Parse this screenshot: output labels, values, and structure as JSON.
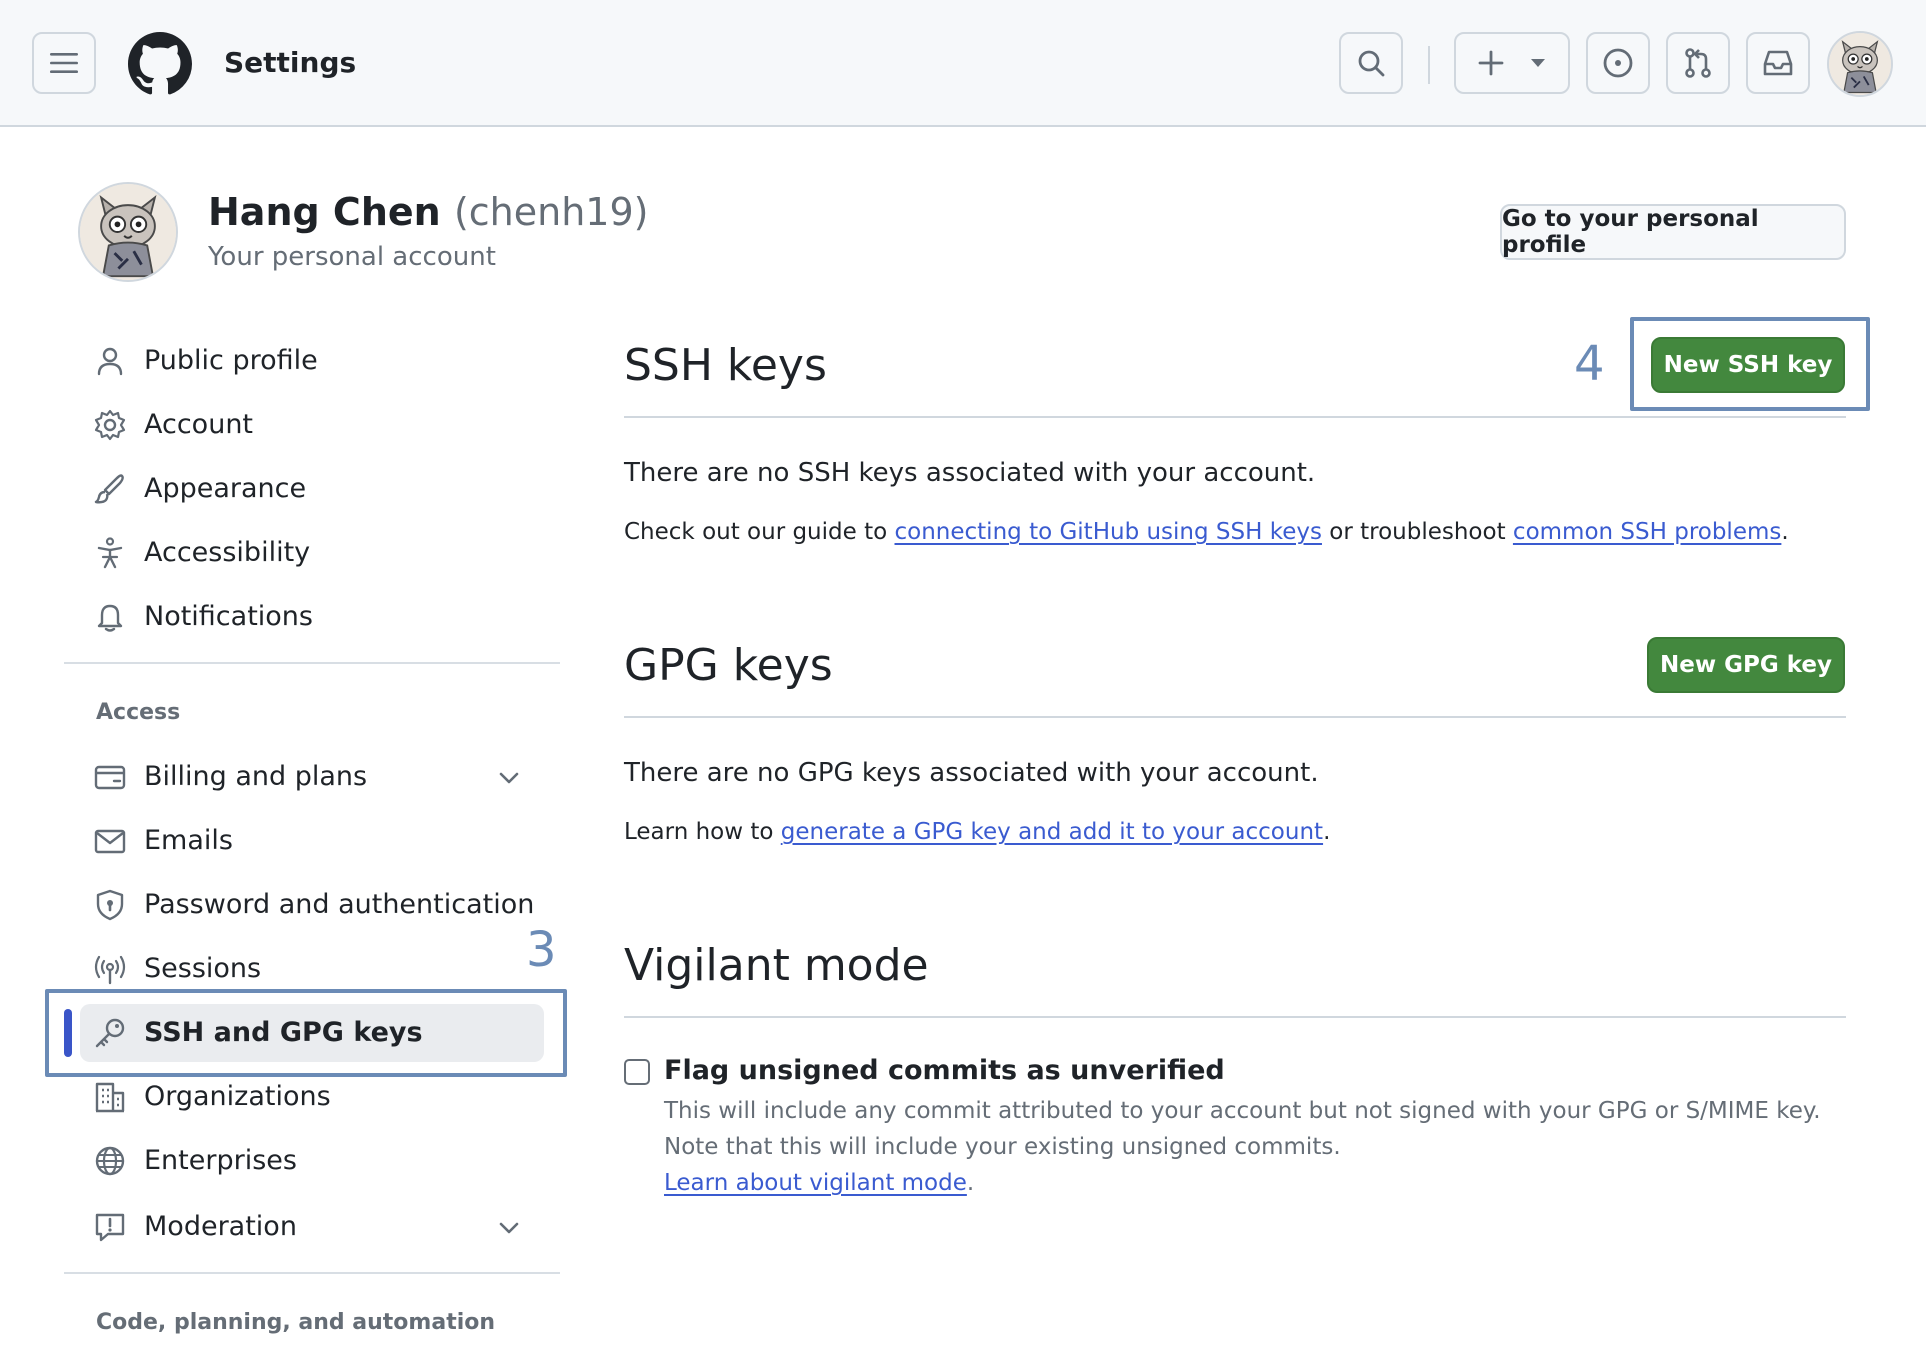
{
  "header": {
    "title": "Settings"
  },
  "profile": {
    "name": "Hang Chen",
    "login": "(chenh19)",
    "subtitle": "Your personal account",
    "profile_button": "Go to your personal profile"
  },
  "sidebar": {
    "items": [
      {
        "label": "Public profile",
        "icon": "person-icon"
      },
      {
        "label": "Account",
        "icon": "gear-icon"
      },
      {
        "label": "Appearance",
        "icon": "paintbrush-icon"
      },
      {
        "label": "Accessibility",
        "icon": "accessibility-icon"
      },
      {
        "label": "Notifications",
        "icon": "bell-icon"
      }
    ],
    "access_heading": "Access",
    "access_items": [
      {
        "label": "Billing and plans",
        "icon": "credit-card-icon"
      },
      {
        "label": "Emails",
        "icon": "mail-icon"
      },
      {
        "label": "Password and authentication",
        "icon": "shield-lock-icon"
      },
      {
        "label": "Sessions",
        "icon": "broadcast-icon"
      },
      {
        "label": "SSH and GPG keys",
        "icon": "key-icon",
        "active": true
      },
      {
        "label": "Organizations",
        "icon": "organization-icon"
      },
      {
        "label": "Enterprises",
        "icon": "globe-icon"
      },
      {
        "label": "Moderation",
        "icon": "report-icon"
      }
    ],
    "code_heading": "Code, planning, and automation"
  },
  "ssh": {
    "title": "SSH keys",
    "new_button": "New SSH key",
    "empty_text": "There are no SSH keys associated with your account.",
    "guide_prefix": "Check out our guide to ",
    "guide_link": "connecting to GitHub using SSH keys",
    "guide_middle": " or troubleshoot ",
    "guide_link2": "common SSH problems",
    "guide_suffix": "."
  },
  "gpg": {
    "title": "GPG keys",
    "new_button": "New GPG key",
    "empty_text": "There are no GPG keys associated with your account.",
    "learn_prefix": "Learn how to ",
    "learn_link": "generate a GPG key and add it to your account",
    "learn_suffix": "."
  },
  "vigilant": {
    "title": "Vigilant mode",
    "checkbox_label": "Flag unsigned commits as unverified",
    "checked": false,
    "note_line1": "This will include any commit attributed to your account but not signed with your GPG or S/MIME key.",
    "note_line2": "Note that this will include your existing unsigned commits.",
    "learn_link": "Learn about vigilant mode",
    "learn_suffix": "."
  },
  "annotations": {
    "step3": "3",
    "step4": "4"
  },
  "colors": {
    "accent_green": "#43883e",
    "link_blue": "#3a5bd0",
    "annotation": "#6b8bb6"
  }
}
